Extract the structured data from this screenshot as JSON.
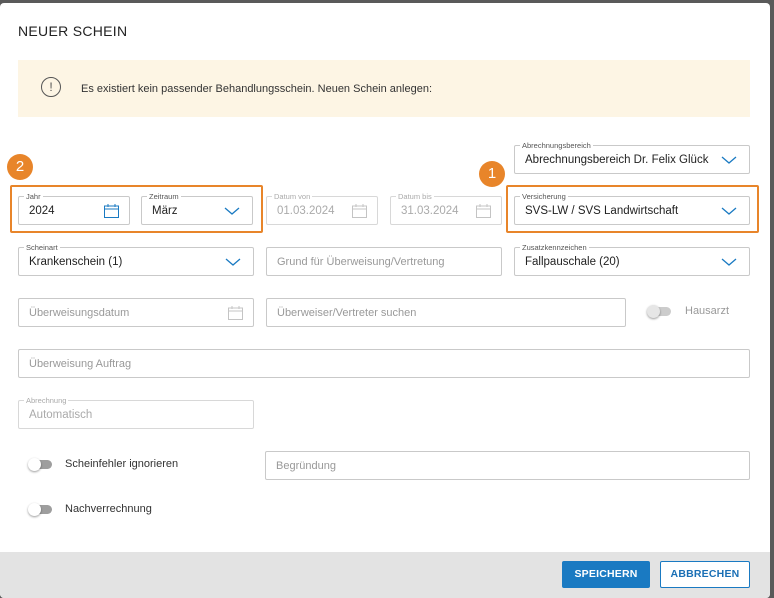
{
  "dialog": {
    "title": "NEUER SCHEIN",
    "banner_text": "Es existiert kein passender Behandlungsschein. Neuen Schein anlegen:",
    "banner_icon": "info-icon"
  },
  "fields": {
    "abrechnungsbereich": {
      "label": "Abrechnungsbereich",
      "value": "Abrechnungsbereich Dr. Felix Glück"
    },
    "jahr": {
      "label": "Jahr",
      "value": "2024"
    },
    "zeitraum": {
      "label": "Zeitraum",
      "value": "März"
    },
    "datum_von": {
      "label": "Datum von",
      "value": "01.03.2024"
    },
    "datum_bis": {
      "label": "Datum bis",
      "value": "31.03.2024"
    },
    "versicherung": {
      "label": "Versicherung",
      "value": "SVS-LW / SVS Landwirtschaft"
    },
    "scheinart": {
      "label": "Scheinart",
      "value": "Krankenschein (1)"
    },
    "grund": {
      "placeholder": "Grund für Überweisung/Vertretung"
    },
    "zusatzkennzeichen": {
      "label": "Zusatzkennzeichen",
      "value": "Fallpauschale (20)"
    },
    "ueberweisungsdatum": {
      "placeholder": "Überweisungsdatum"
    },
    "ueberweiser": {
      "placeholder": "Überweiser/Vertreter suchen"
    },
    "hausarzt": {
      "label": "Hausarzt"
    },
    "ueberweisung_auftrag": {
      "placeholder": "Überweisung Auftrag"
    },
    "abrechnung": {
      "label": "Abrechnung",
      "value": "Automatisch"
    },
    "scheinfehler": {
      "label": "Scheinfehler ignorieren"
    },
    "begruendung": {
      "placeholder": "Begründung"
    },
    "nachverrechnung": {
      "label": "Nachverrechnung"
    }
  },
  "annotations": {
    "badge_1": "1",
    "badge_2": "2",
    "color": "#e8852a"
  },
  "footer": {
    "save_label": "SPEICHERN",
    "cancel_label": "ABBRECHEN"
  },
  "colors": {
    "primary": "#1a7ac2",
    "banner_bg": "#fdf5e4",
    "footer_bg": "#e3e3e3"
  }
}
